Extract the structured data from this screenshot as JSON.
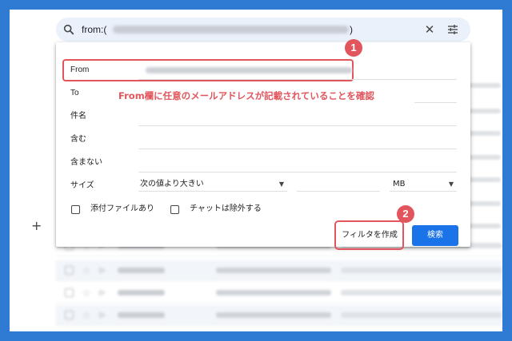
{
  "search": {
    "query_prefix": "from:(",
    "query_suffix": ")",
    "close_label": "✕"
  },
  "plus_label": "+",
  "form": {
    "from_label": "From",
    "to_label": "To",
    "subject_label": "件名",
    "has_words_label": "含む",
    "doesnt_have_label": "含まない",
    "size_label": "サイズ",
    "size_operator": "次の値より大きい",
    "size_unit": "MB",
    "has_attachment_label": "添付ファイルあり",
    "exclude_chats_label": "チャットは除外する"
  },
  "buttons": {
    "create_filter": "フィルタを作成",
    "search": "検索"
  },
  "annotations": {
    "step1_number": "1",
    "step1_text": "From欄に任意のメールアドレスが記載されていることを確認",
    "step2_number": "2"
  },
  "colors": {
    "frame_background": "#2f7bd4",
    "highlight": "#e2555c",
    "primary_button": "#1a73e8",
    "search_bar": "#eaf1fb"
  }
}
